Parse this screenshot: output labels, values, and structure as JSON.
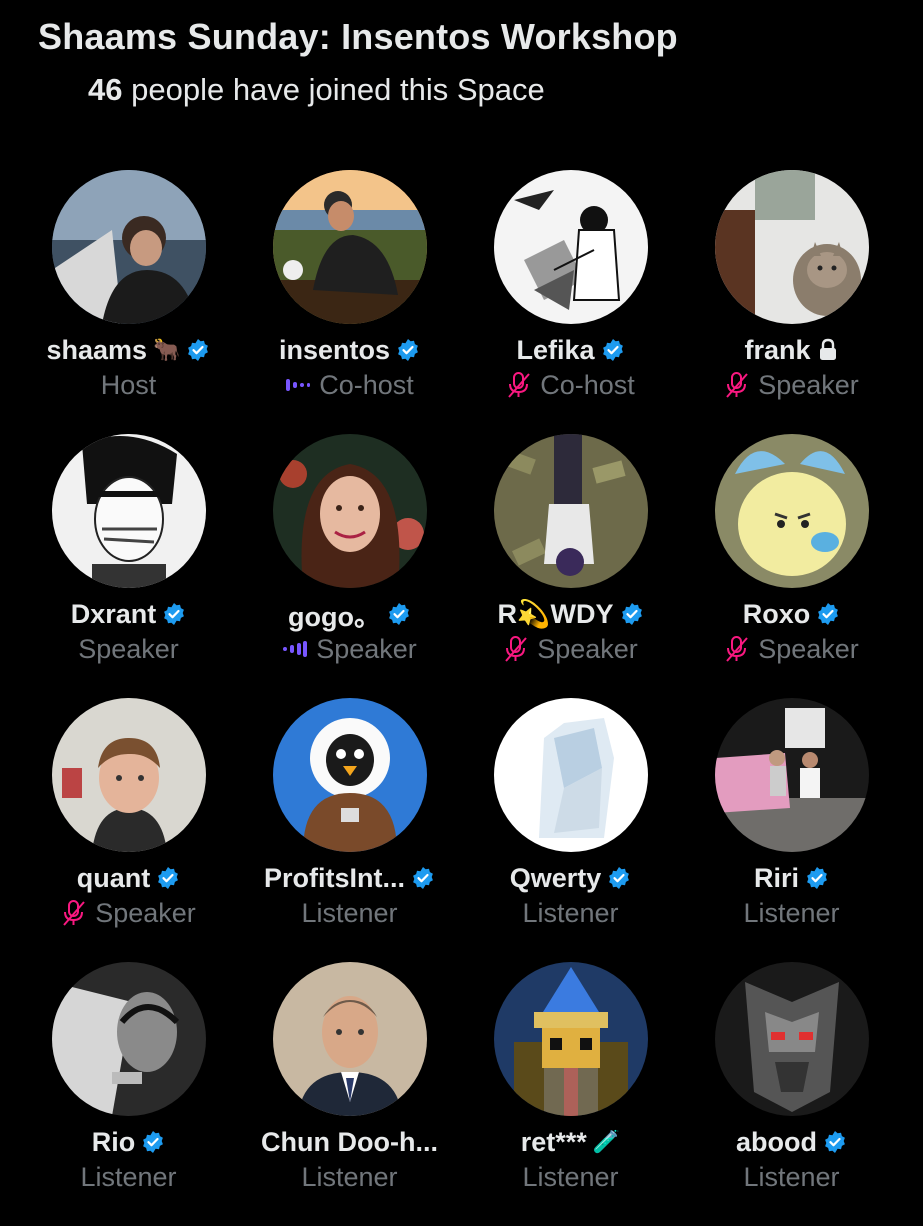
{
  "header": {
    "title": "Shaams Sunday: Insentos Workshop",
    "count": "46",
    "count_text": "people have joined this Space"
  },
  "colors": {
    "background": "#000000",
    "text": "#e7e9ea",
    "muted": "#71767b",
    "verified": "#1d9bf0",
    "mute_icon": "#f91880",
    "speaking": "#7856ff"
  },
  "participants": [
    {
      "name": "shaams",
      "suffix": "🐂",
      "verified": true,
      "role": "Host",
      "status": "none"
    },
    {
      "name": "insentos",
      "suffix": "",
      "verified": true,
      "role": "Co-host",
      "status": "speaking"
    },
    {
      "name": "Lefika",
      "suffix": "",
      "verified": true,
      "role": "Co-host",
      "status": "muted"
    },
    {
      "name": "frank",
      "suffix": "",
      "verified": false,
      "locked": true,
      "role": "Speaker",
      "status": "muted"
    },
    {
      "name": "Dxrant",
      "suffix": "",
      "verified": true,
      "role": "Speaker",
      "status": "none"
    },
    {
      "name": "gogo。",
      "suffix": "",
      "verified": true,
      "role": "Speaker",
      "status": "speaking"
    },
    {
      "name": "R💫WDY",
      "suffix": "",
      "verified": true,
      "role": "Speaker",
      "status": "muted"
    },
    {
      "name": "Roxo",
      "suffix": "",
      "verified": true,
      "role": "Speaker",
      "status": "muted"
    },
    {
      "name": "quant",
      "suffix": "",
      "verified": true,
      "role": "Speaker",
      "status": "muted"
    },
    {
      "name": "ProfitsInt...",
      "suffix": "",
      "verified": true,
      "role": "Listener",
      "status": "none"
    },
    {
      "name": "Qwerty",
      "suffix": "",
      "verified": true,
      "role": "Listener",
      "status": "none"
    },
    {
      "name": "Riri",
      "suffix": "",
      "verified": true,
      "role": "Listener",
      "status": "none"
    },
    {
      "name": "Rio",
      "suffix": "",
      "verified": true,
      "role": "Listener",
      "status": "none"
    },
    {
      "name": "Chun Doo-h...",
      "suffix": "",
      "verified": false,
      "role": "Listener",
      "status": "none"
    },
    {
      "name": "ret***",
      "suffix": "🧪",
      "verified": false,
      "role": "Listener",
      "status": "none"
    },
    {
      "name": "abood",
      "suffix": "",
      "verified": true,
      "role": "Listener",
      "status": "none"
    }
  ]
}
